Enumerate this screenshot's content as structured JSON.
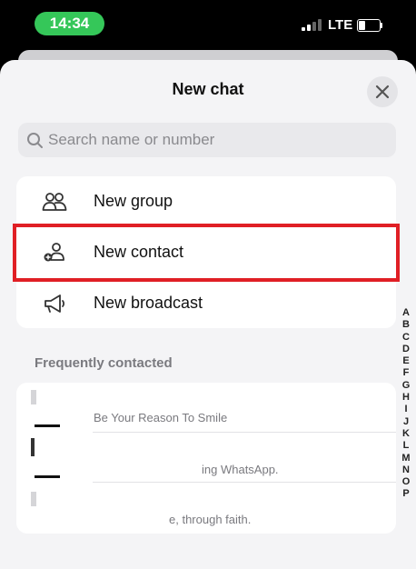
{
  "status_bar": {
    "time": "14:34",
    "network": "LTE",
    "battery_level": 0.35,
    "signal_bars": 2
  },
  "sheet": {
    "title": "New chat",
    "close_icon": "close-icon"
  },
  "search": {
    "placeholder": "Search name or number",
    "icon": "search-icon"
  },
  "menu": [
    {
      "label": "New group",
      "icon": "group-icon"
    },
    {
      "label": "New contact",
      "icon": "add-contact-icon",
      "highlighted": true
    },
    {
      "label": "New broadcast",
      "icon": "megaphone-icon"
    }
  ],
  "frequent": {
    "label": "Frequently contacted",
    "contacts": [
      {
        "status": "Be Your Reason To Smile"
      },
      {
        "status": "ing WhatsApp."
      },
      {
        "status": "e, through faith."
      }
    ]
  },
  "index_letters": [
    "A",
    "B",
    "C",
    "D",
    "E",
    "F",
    "G",
    "H",
    "I",
    "J",
    "K",
    "L",
    "M",
    "N",
    "O",
    "P"
  ],
  "colors": {
    "time_pill": "#35c759",
    "highlight_border": "#e01f25",
    "sheet_bg": "#f4f4f6"
  }
}
